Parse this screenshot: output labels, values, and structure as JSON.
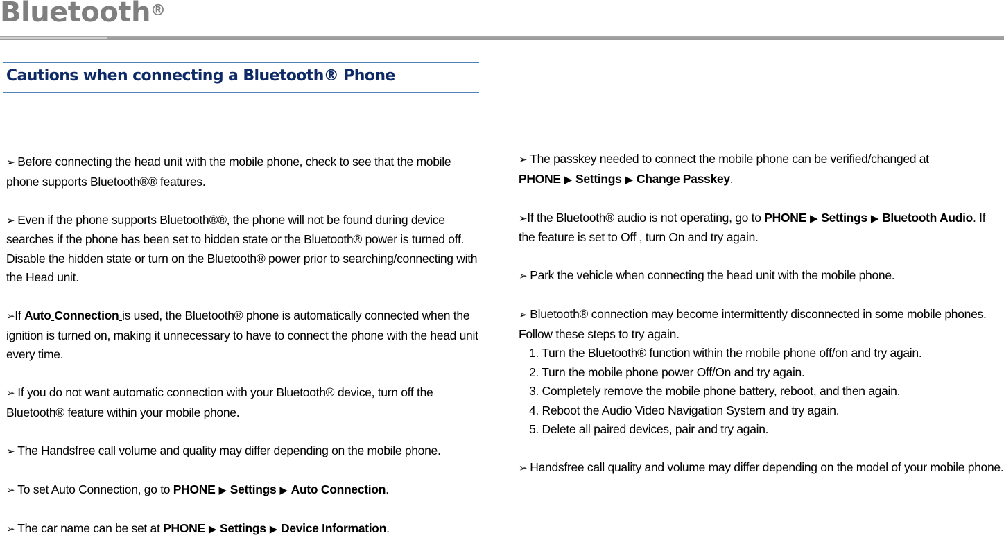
{
  "page": {
    "title": "Bluetooth",
    "title_mark": "®"
  },
  "section": {
    "heading": "Cautions when connecting a Bluetooth® Phone"
  },
  "symbols": {
    "bullet": "➢",
    "arrow": "▶",
    "registered": "®"
  },
  "left_column": {
    "p1": {
      "text": "Before connecting the head unit with the mobile phone, check to see that the mobile phone supports Bluetooth®® features."
    },
    "p2": {
      "text": "Even if the phone supports Bluetooth®®, the phone will not be found during device searches if the phone has been set to hidden state or the Bluetooth® power is turned off. Disable the hidden state or turn on the Bluetooth® power prior to searching/connecting with the Head unit."
    },
    "p3": {
      "prefix": "If ",
      "bold_a": "Auto",
      "bold_b": "Connection",
      "suffix": " is used, the Bluetooth® phone is automatically connected when the ignition is turned on, making it unnecessary to have to connect the phone with the head unit every time."
    },
    "p4": {
      "text": "If you do not want automatic connection with your Bluetooth® device, turn off the Bluetooth® feature within your mobile phone."
    },
    "p5": {
      "text": "The Handsfree call volume and quality may differ depending on the mobile phone."
    },
    "p6": {
      "prefix": "To set Auto Connection, go to ",
      "path": [
        "PHONE",
        "Settings",
        "Auto Connection"
      ],
      "suffix": "."
    },
    "p7": {
      "prefix": "The car name can be set at ",
      "path": [
        "PHONE",
        "Settings",
        "Device Information"
      ],
      "suffix": "."
    }
  },
  "right_column": {
    "p1": {
      "prefix": "The passkey needed to connect the mobile phone can be verified/changed at ",
      "path": [
        "PHONE",
        "Settings",
        "Change Passkey"
      ],
      "suffix": "."
    },
    "p2": {
      "prefix": "If the Bluetooth® audio is not operating, go to ",
      "path": [
        "PHONE",
        "Settings",
        "Bluetooth Audio"
      ],
      "suffix": ". If the feature is set to Off , turn On and try again."
    },
    "p3": {
      "text": "Park the vehicle when connecting the head unit with the mobile phone."
    },
    "p4": {
      "intro": "Bluetooth® connection may become intermittently disconnected in some mobile phones. Follow these steps to try again.",
      "steps": [
        "1. Turn the Bluetooth® function within the mobile phone off/on and try again.",
        "2. Turn the mobile phone power Off/On and try again.",
        "3. Completely remove the mobile phone battery, reboot, and then again.",
        "4. Reboot the Audio Video Navigation System and try again.",
        "5. Delete all paired devices, pair and try again."
      ]
    },
    "p5": {
      "text": "Handsfree call quality and volume may differ depending on the model of your mobile phone."
    }
  },
  "colors": {
    "title_gray": "#7f7f7f",
    "rule_gray": "#a6a6a6",
    "heading_navy": "#0e2a66",
    "heading_rule_blue": "#4f81bd"
  }
}
